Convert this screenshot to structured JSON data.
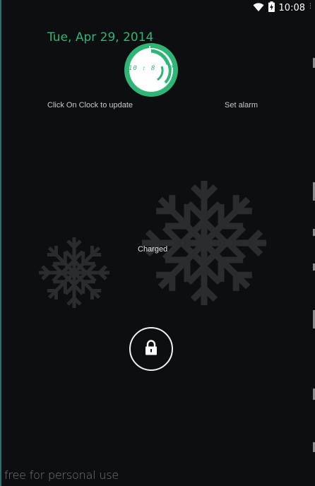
{
  "status_bar": {
    "time": "10:08",
    "icons": [
      "wifi-icon",
      "battery-charging-icon"
    ]
  },
  "lockscreen": {
    "date": "Tue, Apr 29, 2014",
    "clock_text": "10 : 8 : 2",
    "click_hint": "Click On Clock to update",
    "set_alarm": "Set alarm",
    "battery_status": "Charged",
    "watermark": "free for personal use"
  },
  "colors": {
    "accent": "#2fb575",
    "background": "#0d0e10",
    "snowflake": "#2b2c2e"
  },
  "icons": {
    "lock": "lock-icon",
    "snowflake_large": "snowflake-icon",
    "snowflake_small": "snowflake-icon"
  }
}
